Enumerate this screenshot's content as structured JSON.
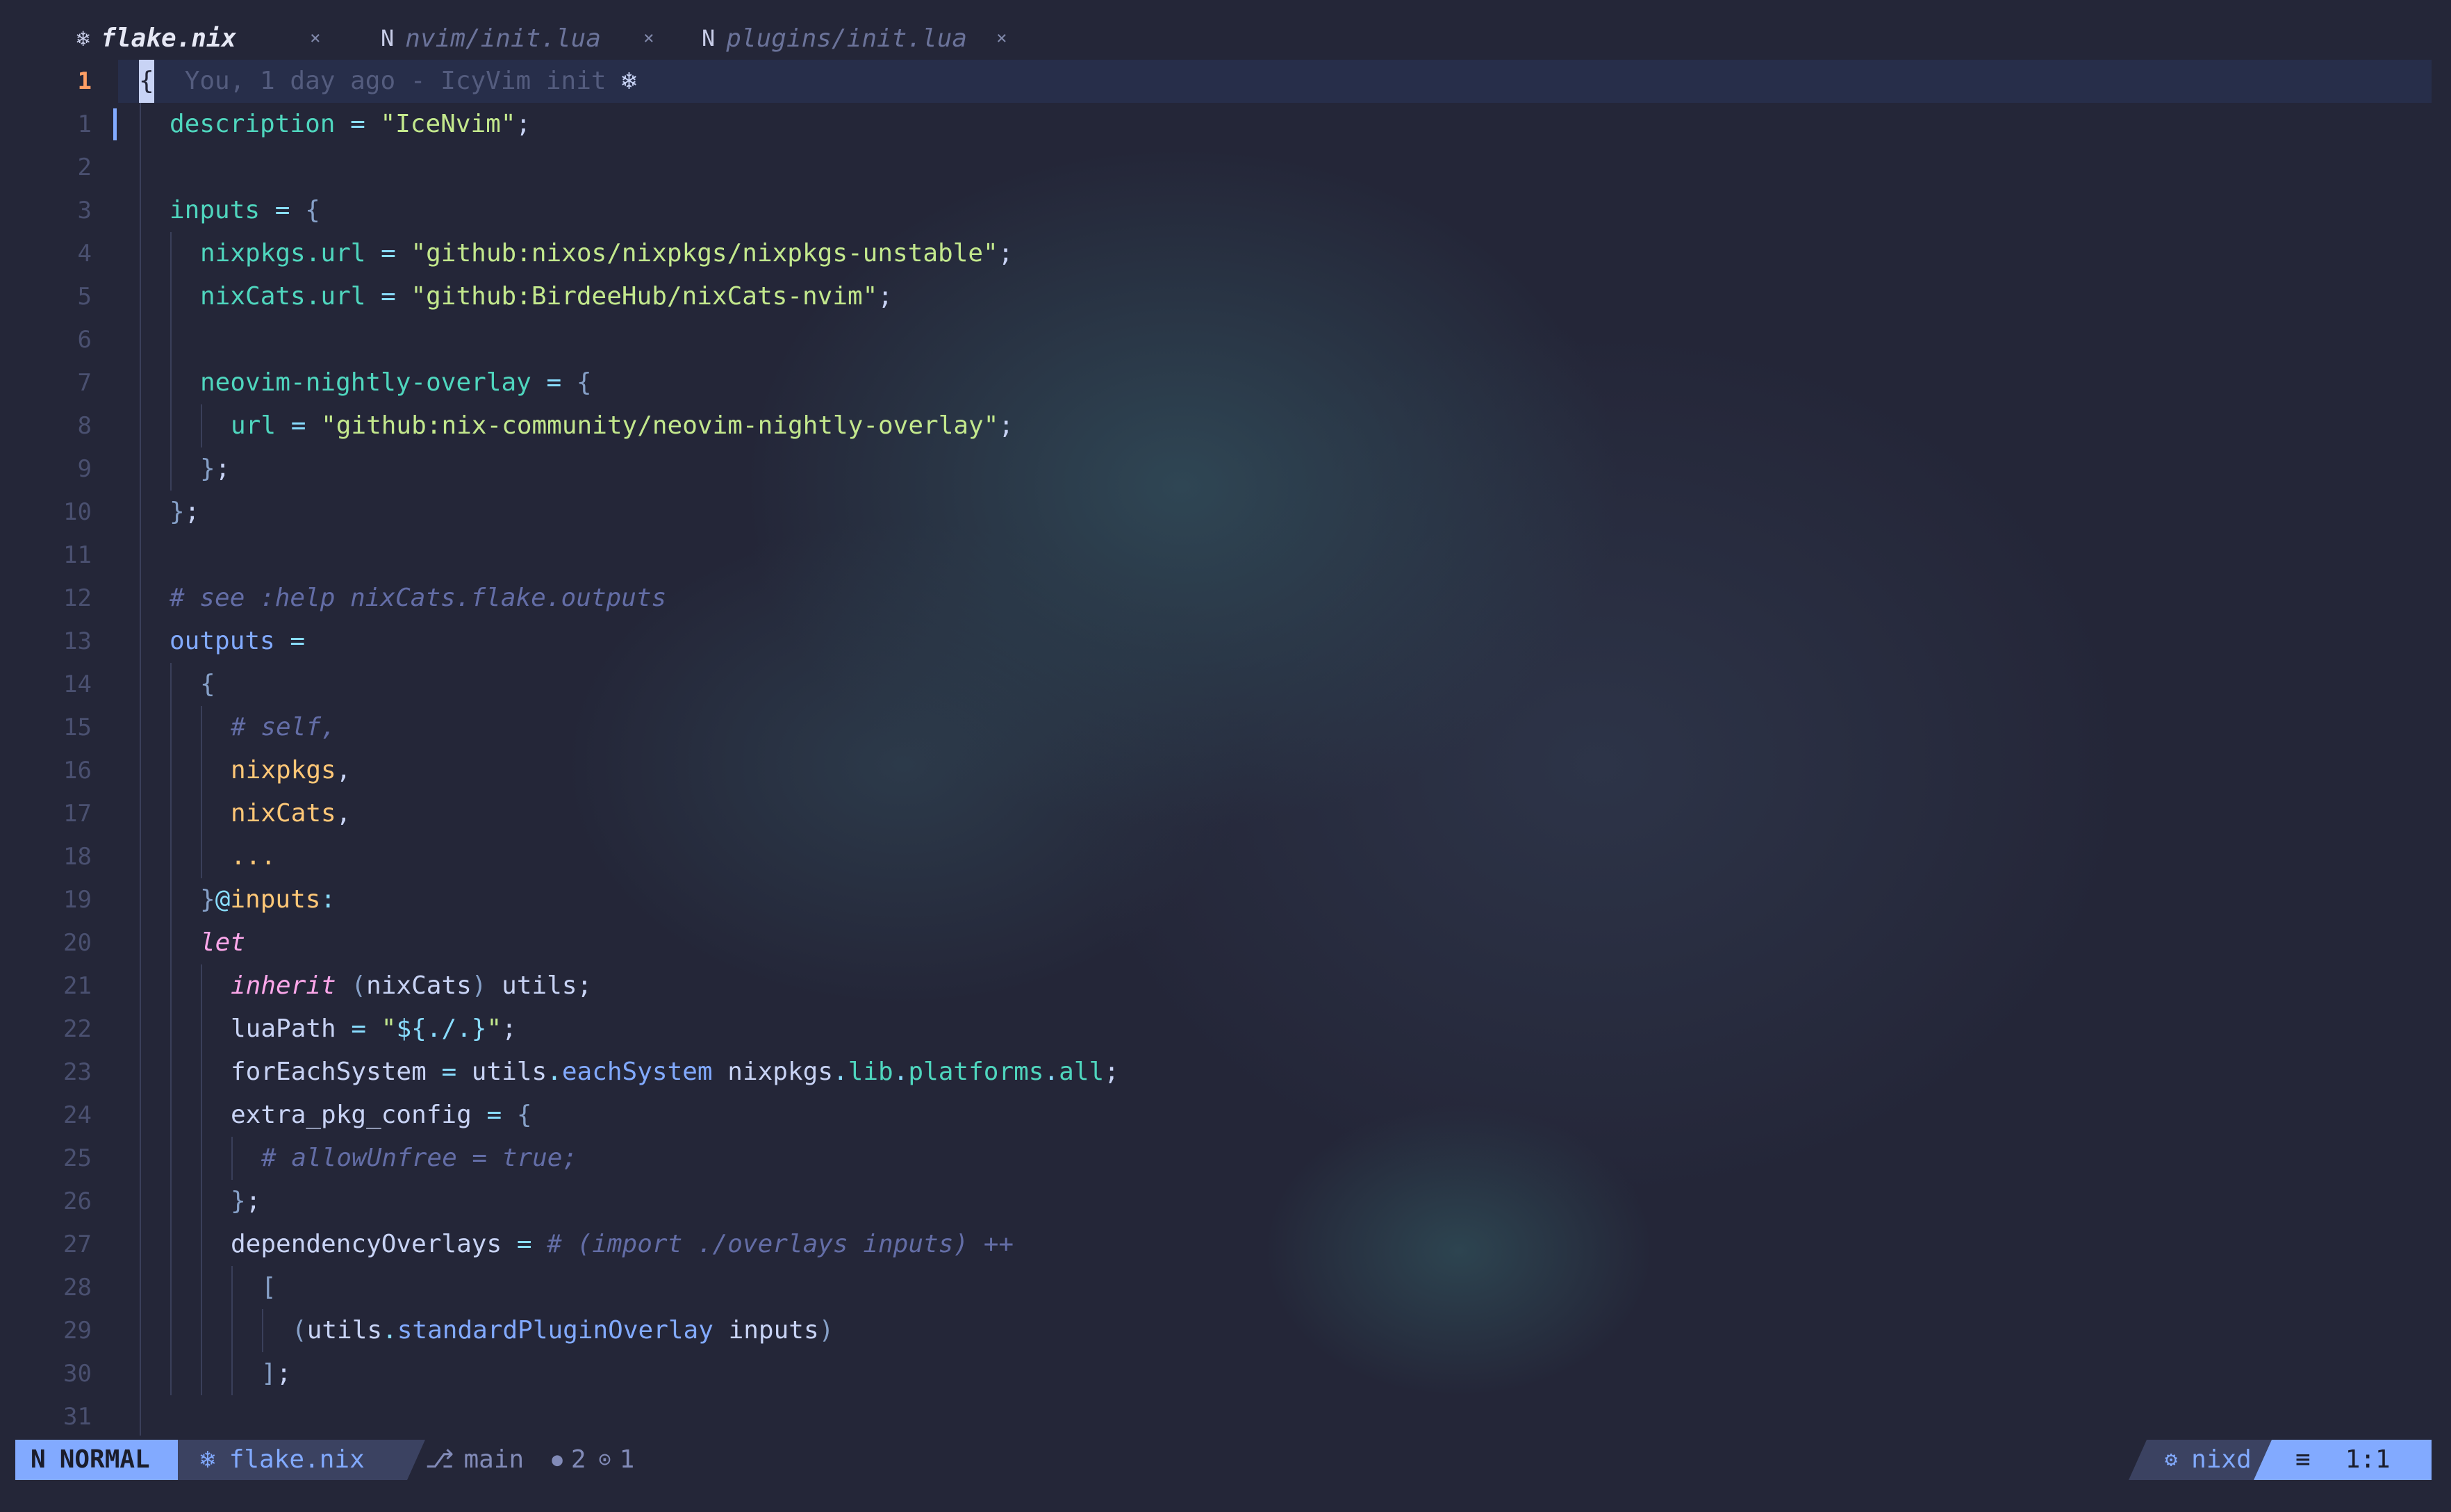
{
  "tabs": [
    {
      "icon": "❄",
      "label": "flake.nix",
      "close": "×",
      "active": true
    },
    {
      "icon": "N",
      "label": "nvim/init.lua",
      "close": "×",
      "active": false
    },
    {
      "icon": "N",
      "label": "plugins/init.lua",
      "close": "×",
      "active": false
    }
  ],
  "blame": "You, 1 day ago - IcyVim init",
  "blame_icon": "❄",
  "lines": [
    {
      "num": "1",
      "tokens": [
        [
          "cursor",
          "{"
        ]
      ]
    },
    {
      "num": "1",
      "tokens": [
        [
          "attr",
          "description"
        ],
        [
          "op",
          " = "
        ],
        [
          "str",
          "\"IceNvim\""
        ],
        [
          "punc",
          ";"
        ]
      ]
    },
    {
      "num": "2",
      "tokens": []
    },
    {
      "num": "3",
      "tokens": [
        [
          "attr",
          "inputs"
        ],
        [
          "op",
          " = "
        ],
        [
          "brace",
          "{"
        ]
      ]
    },
    {
      "num": "4",
      "tokens": [
        [
          "attr",
          "nixpkgs.url"
        ],
        [
          "op",
          " = "
        ],
        [
          "str",
          "\"github:nixos/nixpkgs/nixpkgs-unstable\""
        ],
        [
          "punc",
          ";"
        ]
      ]
    },
    {
      "num": "5",
      "tokens": [
        [
          "attr",
          "nixCats.url"
        ],
        [
          "op",
          " = "
        ],
        [
          "str",
          "\"github:BirdeeHub/nixCats-nvim\""
        ],
        [
          "punc",
          ";"
        ]
      ]
    },
    {
      "num": "6",
      "tokens": []
    },
    {
      "num": "7",
      "tokens": [
        [
          "attr",
          "neovim-nightly-overlay"
        ],
        [
          "op",
          " = "
        ],
        [
          "brace",
          "{"
        ]
      ]
    },
    {
      "num": "8",
      "tokens": [
        [
          "attr",
          "url"
        ],
        [
          "op",
          " = "
        ],
        [
          "str",
          "\"github:nix-community/neovim-nightly-overlay\""
        ],
        [
          "punc",
          ";"
        ]
      ]
    },
    {
      "num": "9",
      "tokens": [
        [
          "brace",
          "}"
        ],
        [
          "punc",
          ";"
        ]
      ]
    },
    {
      "num": "10",
      "tokens": [
        [
          "brace",
          "}"
        ],
        [
          "punc",
          ";"
        ]
      ]
    },
    {
      "num": "11",
      "tokens": []
    },
    {
      "num": "12",
      "tokens": [
        [
          "cmt",
          "# see :help nixCats.flake.outputs"
        ]
      ]
    },
    {
      "num": "13",
      "tokens": [
        [
          "fn",
          "outputs"
        ],
        [
          "op",
          " ="
        ]
      ]
    },
    {
      "num": "14",
      "tokens": [
        [
          "brace",
          "{"
        ]
      ]
    },
    {
      "num": "15",
      "tokens": [
        [
          "cmt",
          "# self,"
        ]
      ]
    },
    {
      "num": "16",
      "tokens": [
        [
          "param",
          "nixpkgs"
        ],
        [
          "punc",
          ","
        ]
      ]
    },
    {
      "num": "17",
      "tokens": [
        [
          "param",
          "nixCats"
        ],
        [
          "punc",
          ","
        ]
      ]
    },
    {
      "num": "18",
      "tokens": [
        [
          "param",
          "..."
        ]
      ]
    },
    {
      "num": "19",
      "tokens": [
        [
          "brace",
          "}"
        ],
        [
          "op",
          "@"
        ],
        [
          "param",
          "inputs"
        ],
        [
          "op",
          ":"
        ]
      ]
    },
    {
      "num": "20",
      "tokens": [
        [
          "kw",
          "let"
        ]
      ]
    },
    {
      "num": "21",
      "tokens": [
        [
          "kw",
          "inherit"
        ],
        [
          "brace",
          " ("
        ],
        [
          "var",
          "nixCats"
        ],
        [
          "brace",
          ")"
        ],
        [
          "var",
          " utils"
        ],
        [
          "punc",
          ";"
        ]
      ]
    },
    {
      "num": "22",
      "tokens": [
        [
          "var",
          "luaPath"
        ],
        [
          "op",
          " = "
        ],
        [
          "str",
          "\""
        ],
        [
          "op",
          "${./.}"
        ],
        [
          "str",
          "\""
        ],
        [
          "punc",
          ";"
        ]
      ]
    },
    {
      "num": "23",
      "tokens": [
        [
          "var",
          "forEachSystem"
        ],
        [
          "op",
          " = "
        ],
        [
          "var",
          "utils"
        ],
        [
          "op",
          "."
        ],
        [
          "fn",
          "eachSystem"
        ],
        [
          "var",
          " nixpkgs"
        ],
        [
          "op",
          "."
        ],
        [
          "attr",
          "lib"
        ],
        [
          "op",
          "."
        ],
        [
          "attr",
          "platforms"
        ],
        [
          "op",
          "."
        ],
        [
          "attr",
          "all"
        ],
        [
          "punc",
          ";"
        ]
      ]
    },
    {
      "num": "24",
      "tokens": [
        [
          "var",
          "extra_pkg_config"
        ],
        [
          "op",
          " = "
        ],
        [
          "brace",
          "{"
        ]
      ]
    },
    {
      "num": "25",
      "tokens": [
        [
          "cmt",
          "# allowUnfree = true;"
        ]
      ]
    },
    {
      "num": "26",
      "tokens": [
        [
          "brace",
          "}"
        ],
        [
          "punc",
          ";"
        ]
      ]
    },
    {
      "num": "27",
      "tokens": [
        [
          "var",
          "dependencyOverlays"
        ],
        [
          "op",
          " = "
        ],
        [
          "cmt",
          "# (import ./overlays inputs) ++"
        ]
      ]
    },
    {
      "num": "28",
      "tokens": [
        [
          "brace",
          "["
        ]
      ]
    },
    {
      "num": "29",
      "tokens": [
        [
          "brace",
          "("
        ],
        [
          "var",
          "utils"
        ],
        [
          "op",
          "."
        ],
        [
          "fn",
          "standardPluginOverlay"
        ],
        [
          "var",
          " inputs"
        ],
        [
          "brace",
          ")"
        ]
      ]
    },
    {
      "num": "30",
      "tokens": [
        [
          "brace",
          "]"
        ],
        [
          "punc",
          ";"
        ]
      ]
    },
    {
      "num": "31",
      "tokens": []
    }
  ],
  "statusline": {
    "mode_icon": "N",
    "mode": "NORMAL",
    "file_icon": "❄",
    "file": "flake.nix",
    "branch_icon": "⎇",
    "branch": "main",
    "diag_hint_icon": "●",
    "diag_hint_count": "2",
    "diag_info_icon": "⊙",
    "diag_info_count": "1",
    "lsp_icon": "⚙",
    "lsp": "nixd",
    "pos_icon": "≡",
    "position": "1:1"
  },
  "colors": {
    "background": "#242638",
    "accent": "#82aaff",
    "cursor_line_number": "#ff9e64"
  }
}
